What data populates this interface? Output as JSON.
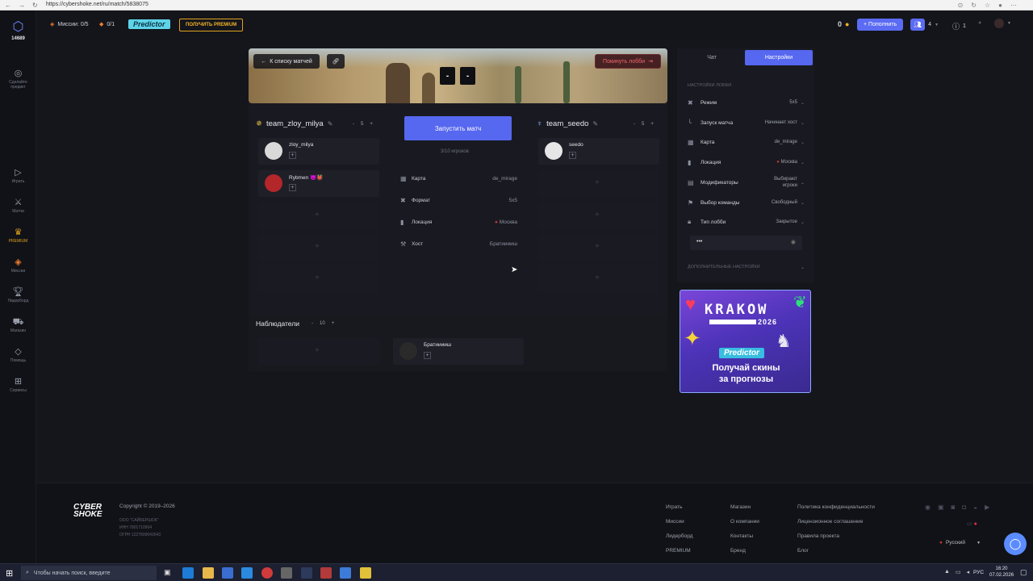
{
  "browser": {
    "url": "https://cybershoke.net/ru/match/5838075"
  },
  "sidebar": {
    "logo_value": "14689",
    "items": [
      {
        "label": "Сделайте\nпредикт",
        "icon": "predict-icon"
      },
      {
        "label": "Играть",
        "icon": "play-icon"
      },
      {
        "label": "Матчи",
        "icon": "matches-icon"
      },
      {
        "label": "PREMIUM",
        "icon": "crown-icon"
      },
      {
        "label": "Миссии",
        "icon": "missions-icon"
      },
      {
        "label": "Лидерборд",
        "icon": "trophy-icon"
      },
      {
        "label": "Магазин",
        "icon": "cart-icon"
      },
      {
        "label": "Помощь",
        "icon": "help-icon"
      },
      {
        "label": "Сервисы",
        "icon": "services-icon"
      }
    ]
  },
  "topbar": {
    "missions": "Миссии: 0/5",
    "second_counter": "0/1",
    "predictor": "Predictor",
    "premium_button": "ПОЛУЧИТЬ PREMIUM",
    "balance": "0",
    "topup_button": "+ Пополнить",
    "friends_count": "4",
    "notif_count": "1"
  },
  "lobby": {
    "back_button": "К списку матчей",
    "leave_button": "Покинуть лобби",
    "score_left": "-",
    "score_right": "-",
    "team1": {
      "name": "team_zloy_milya",
      "count": "5",
      "minus": "-",
      "plus": "+",
      "players": [
        {
          "name": "zloy_milya"
        },
        {
          "name": "Rybmen 😈👹"
        }
      ]
    },
    "team2": {
      "name": "team_seedo",
      "count": "5",
      "minus": "-",
      "plus": "+",
      "players": [
        {
          "name": "seedo"
        }
      ]
    },
    "start_button": "Запустить матч",
    "players_count": "3/10 игроков",
    "info": [
      {
        "label": "Карта",
        "value": "de_mirage",
        "icon": "map-icon"
      },
      {
        "label": "Формат",
        "value": "5x5",
        "icon": "format-icon"
      },
      {
        "label": "Локация",
        "value": "Москва",
        "icon": "location-icon"
      },
      {
        "label": "Хост",
        "value": "Братииииш",
        "icon": "host-icon"
      }
    ],
    "observers": {
      "title": "Наблюдатели",
      "count": "10",
      "minus": "-",
      "plus": "+",
      "members": [
        {
          "name": "Братииииш"
        }
      ]
    }
  },
  "right_panel": {
    "tab_chat": "Чат",
    "tab_settings": "Настройки",
    "section_title": "НАСТРОЙКИ ЛОББИ",
    "settings": [
      {
        "label": "Режим",
        "value": "5x5",
        "icon": "mode-icon"
      },
      {
        "label": "Запуск матча",
        "value": "Начинает хост",
        "icon": "launch-icon"
      },
      {
        "label": "Карта",
        "value": "de_mirage",
        "icon": "map-icon"
      },
      {
        "label": "Локация",
        "value": "Москва",
        "icon": "location-icon"
      },
      {
        "label": "Модификаторы",
        "value": "Выбирают игроки",
        "icon": "modifiers-icon"
      },
      {
        "label": "Выбор команды",
        "value": "Свободный",
        "icon": "team-select-icon"
      },
      {
        "label": "Тип лобби",
        "value": "Закрытое",
        "icon": "lock-icon"
      }
    ],
    "password_value": "•••",
    "extra_settings": "ДОПОЛНИТЕЛЬНЫЕ НАСТРОЙКИ"
  },
  "ad": {
    "headline": "KRAKOW",
    "year": "2026",
    "brand": "Predictor",
    "text1": "Получай скины",
    "text2": "за прогнозы"
  },
  "footer": {
    "logo1": "CYBER",
    "logo2": "SHOKE",
    "copyright": "Copyright © 2019–2026",
    "company": "ООО \"САЙБЕРШОК\"",
    "inn": "ИНН 7801710904",
    "ogrn": "ОГРН 1227800042643",
    "col1": [
      "Играть",
      "Миссии",
      "Лидерборд",
      "PREMIUM"
    ],
    "col2": [
      "Магазин",
      "О компании",
      "Контакты",
      "Бренд"
    ],
    "col3": [
      "Политика конфиденциальности",
      "Лицензионное соглашение",
      "Правила проекта",
      "Блог"
    ],
    "language": "Русский"
  },
  "taskbar": {
    "search_placeholder": "Чтобы начать поиск, введите",
    "lang": "РУС",
    "time": "16:20",
    "date": "07.02.2026"
  }
}
